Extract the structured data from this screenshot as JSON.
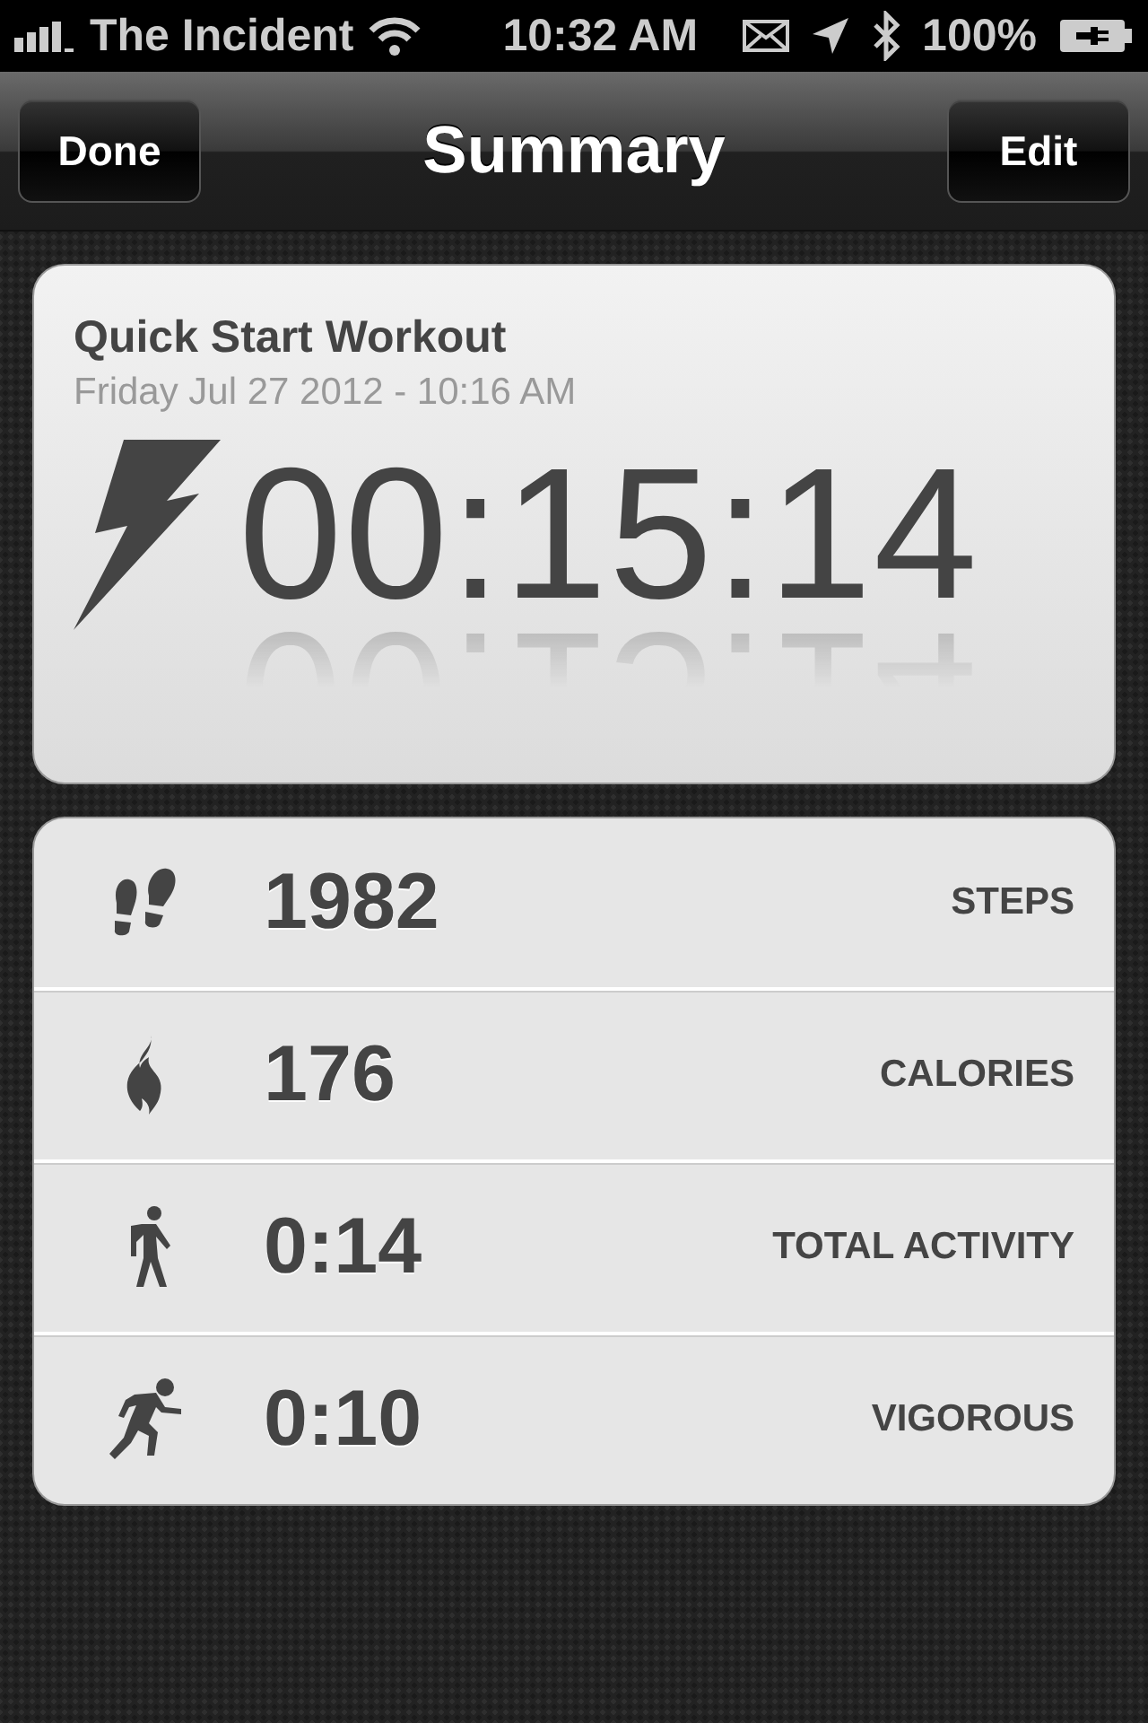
{
  "status_bar": {
    "carrier": "The Incident",
    "time": "10:32 AM",
    "battery": "100%"
  },
  "nav": {
    "title": "Summary",
    "left_button": "Done",
    "right_button": "Edit"
  },
  "workout": {
    "title": "Quick Start Workout",
    "date": "Friday Jul 27 2012 - 10:16 AM",
    "duration": "00:15:14"
  },
  "stats": [
    {
      "kind": "steps",
      "value": "1982",
      "label": "STEPS"
    },
    {
      "kind": "calories",
      "value": "176",
      "label": "CALORIES"
    },
    {
      "kind": "walk",
      "value": "0:14",
      "label": "TOTAL ACTIVITY"
    },
    {
      "kind": "run",
      "value": "0:10",
      "label": "VIGOROUS"
    }
  ]
}
